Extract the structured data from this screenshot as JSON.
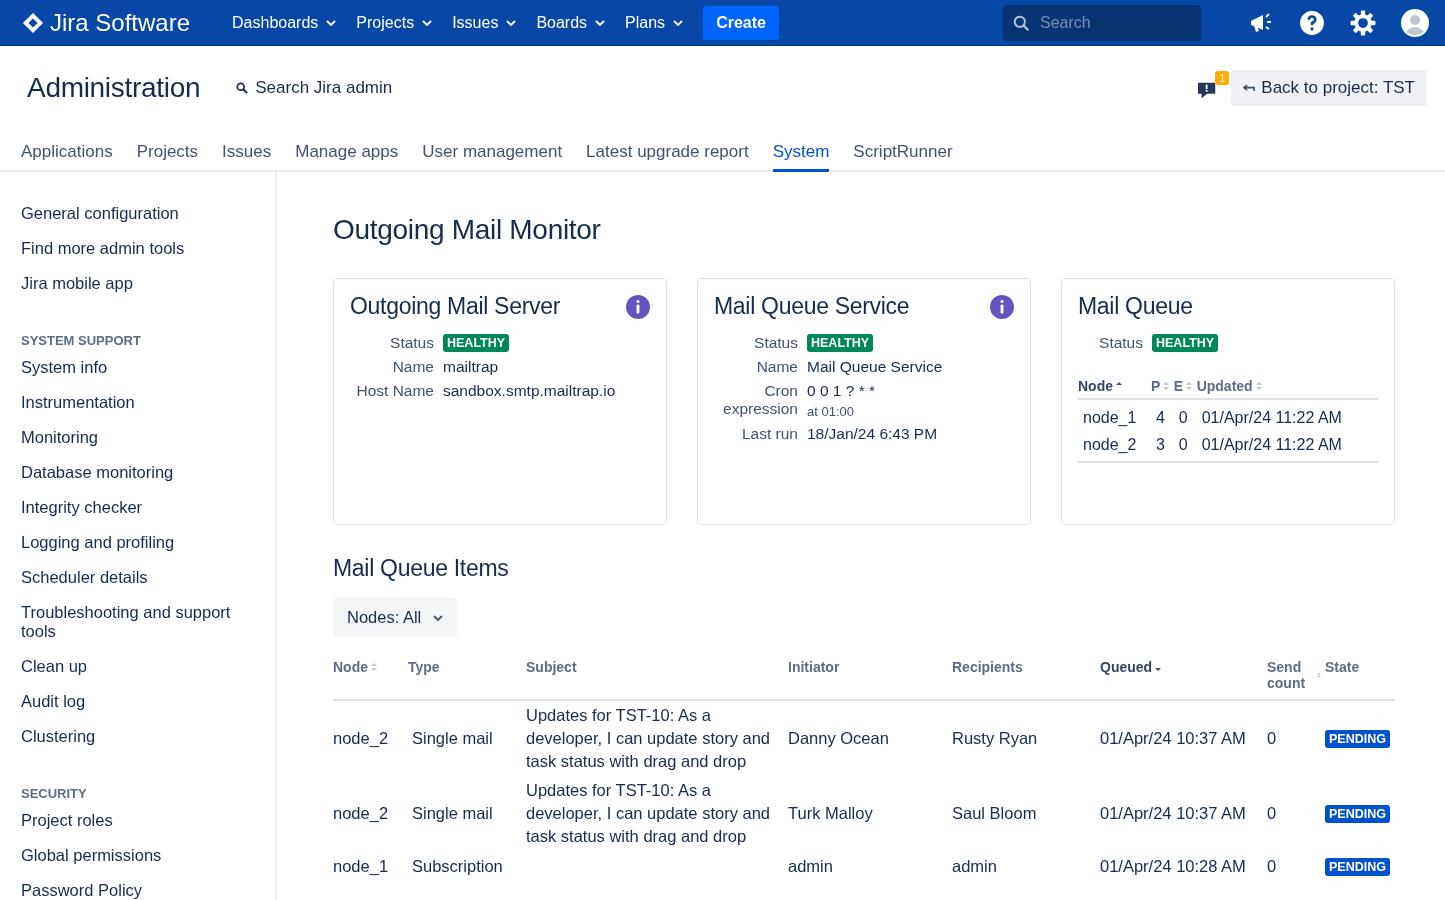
{
  "topnav": {
    "product": "Jira Software",
    "menus": [
      {
        "label": "Dashboards"
      },
      {
        "label": "Projects"
      },
      {
        "label": "Issues"
      },
      {
        "label": "Boards"
      },
      {
        "label": "Plans"
      }
    ],
    "create": "Create",
    "search": {
      "placeholder": "Search"
    }
  },
  "header": {
    "title": "Administration",
    "search_link": "Search Jira admin",
    "notification_count": "1",
    "back_button": "Back to project: TST"
  },
  "tabs": [
    {
      "label": "Applications",
      "selected": false
    },
    {
      "label": "Projects",
      "selected": false
    },
    {
      "label": "Issues",
      "selected": false
    },
    {
      "label": "Manage apps",
      "selected": false
    },
    {
      "label": "User management",
      "selected": false
    },
    {
      "label": "Latest upgrade report",
      "selected": false
    },
    {
      "label": "System",
      "selected": true
    },
    {
      "label": "ScriptRunner",
      "selected": false
    }
  ],
  "sidebar": {
    "sections": [
      {
        "items": [
          "General configuration",
          "Find more admin tools",
          "Jira mobile app"
        ]
      },
      {
        "heading": "SYSTEM SUPPORT",
        "items": [
          "System info",
          "Instrumentation",
          "Monitoring",
          "Database monitoring",
          "Integrity checker",
          "Logging and profiling",
          "Scheduler details",
          "Troubleshooting and support tools",
          "Clean up",
          "Audit log",
          "Clustering"
        ]
      },
      {
        "heading": "SECURITY",
        "items": [
          "Project roles",
          "Global permissions",
          "Password Policy"
        ]
      }
    ]
  },
  "page_title": "Outgoing Mail Monitor",
  "cards": [
    {
      "title": "Outgoing Mail Server",
      "info": true,
      "fields": [
        {
          "label": "Status",
          "kind": "lozenge",
          "value": "HEALTHY"
        },
        {
          "label": "Name",
          "kind": "text",
          "value": "mailtrap"
        },
        {
          "label": "Host Name",
          "kind": "text",
          "value": "sandbox.smtp.mailtrap.io"
        }
      ]
    },
    {
      "title": "Mail Queue Service",
      "info": true,
      "fields": [
        {
          "label": "Status",
          "kind": "lozenge",
          "value": "HEALTHY"
        },
        {
          "label": "Name",
          "kind": "text",
          "value": "Mail Queue Service"
        },
        {
          "label": "Cron expression",
          "kind": "text",
          "value": "0 0 1 ? * *",
          "note": "at 01:00"
        },
        {
          "label": "Last run",
          "kind": "text",
          "value": "18/Jan/24 6:43 PM"
        }
      ]
    },
    {
      "title": "Mail Queue",
      "info": false,
      "fields": [
        {
          "label": "Status",
          "kind": "lozenge",
          "value": "HEALTHY"
        }
      ],
      "table": {
        "columns": [
          {
            "label": "Node",
            "sortable": true,
            "sorted": true,
            "descending": false
          },
          {
            "label": "P",
            "sortable": true,
            "sorted": false
          },
          {
            "label": "E",
            "sortable": true,
            "sorted": false
          },
          {
            "label": "Updated",
            "sortable": true,
            "sorted": false
          }
        ],
        "rows": [
          [
            "node_1",
            "4",
            "0",
            "01/Apr/24 11:22 AM"
          ],
          [
            "node_2",
            "3",
            "0",
            "01/Apr/24 11:22 AM"
          ]
        ]
      }
    }
  ],
  "items_section": {
    "title": "Mail Queue Items",
    "filter": "Nodes: All",
    "columns": [
      {
        "label": "Node",
        "sortable": true,
        "sorted": false
      },
      {
        "label": "Type",
        "sortable": false,
        "sorted": false
      },
      {
        "label": "Subject",
        "sortable": false,
        "sorted": false
      },
      {
        "label": "Initiator",
        "sortable": false,
        "sorted": false
      },
      {
        "label": "Recipients",
        "sortable": false,
        "sorted": false
      },
      {
        "label": "Queued",
        "sortable": true,
        "sorted": true,
        "descending": true
      },
      {
        "label": "Send count",
        "sortable": true,
        "sorted": false
      },
      {
        "label": "State",
        "sortable": false,
        "sorted": false
      }
    ],
    "rows": [
      {
        "node": "node_2",
        "type": "Single mail",
        "subject": "Updates for TST-10: As a developer, I can update story and task status with drag and drop",
        "initiator": "Danny Ocean",
        "recipients": "Rusty Ryan",
        "queued": "01/Apr/24 10:37 AM",
        "send_count": "0",
        "state": "PENDING"
      },
      {
        "node": "node_2",
        "type": "Single mail",
        "subject": "Updates for TST-10: As a developer, I can update story and task status with drag and drop",
        "initiator": "Turk Malloy",
        "recipients": "Saul Bloom",
        "queued": "01/Apr/24 10:37 AM",
        "send_count": "0",
        "state": "PENDING"
      },
      {
        "node": "node_1",
        "type": "Subscription",
        "initiator": "admin",
        "recipients": "admin",
        "queued": "01/Apr/24 10:28 AM",
        "send_count": "0",
        "state": "PENDING"
      }
    ]
  }
}
